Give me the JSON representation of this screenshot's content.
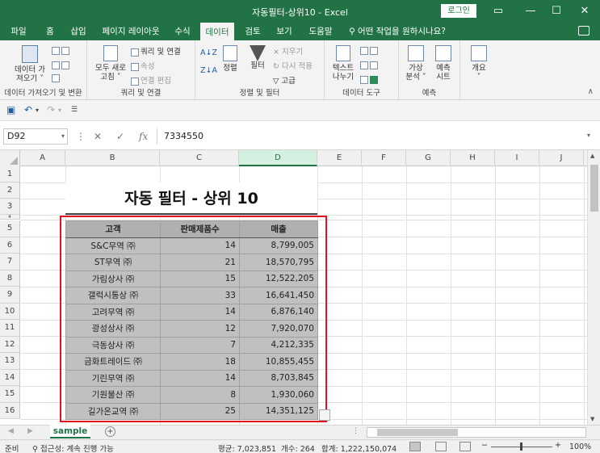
{
  "window": {
    "title": "자동필터-상위10 - Excel",
    "login_label": "로그인",
    "controls": [
      "▭",
      "—",
      "☐",
      "✕"
    ]
  },
  "tabs": [
    {
      "label": "파일"
    },
    {
      "label": "홈"
    },
    {
      "label": "삽입"
    },
    {
      "label": "페이지 레이아웃"
    },
    {
      "label": "수식"
    },
    {
      "label": "데이터"
    },
    {
      "label": "검토"
    },
    {
      "label": "보기"
    },
    {
      "label": "도움말"
    }
  ],
  "tell_me": "어떤 작업을 원하시나요?",
  "ribbon": {
    "get_data": {
      "line1": "데이터 가",
      "line2": "져오기 ˅",
      "group": "데이터 가져오기 및 변환"
    },
    "refresh": {
      "line1": "모두 새로",
      "line2": "고침 ˅"
    },
    "queries": {
      "item1": "쿼리 및 연결",
      "item2": "속성",
      "item3": "연결 편집",
      "group": "쿼리 및 연결"
    },
    "sort": {
      "label": "정렬",
      "az": "A↓Z",
      "za": "Z↓A"
    },
    "filter": {
      "label": "필터",
      "clear": "지우기",
      "reapply": "다시 적용",
      "advanced": "고급",
      "group": "정렬 및 필터"
    },
    "text_to_cols": {
      "line1": "텍스트",
      "line2": "나누기",
      "group": "데이터 도구"
    },
    "whatif": {
      "line1": "가상",
      "line2": "분석 ˅"
    },
    "forecast": {
      "line1": "예측",
      "line2": "시트",
      "group": "예측"
    },
    "outline": {
      "label": "개요",
      "sub": "˅"
    }
  },
  "formula_bar": {
    "name_box": "D92",
    "value": "7334550"
  },
  "columns": [
    "A",
    "B",
    "C",
    "D",
    "E",
    "F",
    "G",
    "H",
    "I",
    "J"
  ],
  "rows": [
    "1",
    "2",
    "3",
    "4",
    "5",
    "6",
    "7",
    "8",
    "9",
    "10",
    "11",
    "12",
    "13",
    "14",
    "15",
    "16"
  ],
  "sheet_title": "자동 필터 - 상위 10",
  "table": {
    "headers": [
      "고객",
      "판매제품수",
      "매출"
    ],
    "rows": [
      [
        "S&C무역 ㈜",
        "14",
        "8,799,005"
      ],
      [
        "ST무역 ㈜",
        "21",
        "18,570,795"
      ],
      [
        "가림상사 ㈜",
        "15",
        "12,522,205"
      ],
      [
        "갤럭시통상 ㈜",
        "33",
        "16,641,450"
      ],
      [
        "고려무역 ㈜",
        "14",
        "6,876,140"
      ],
      [
        "광성상사 ㈜",
        "12",
        "7,920,070"
      ],
      [
        "극동상사 ㈜",
        "7",
        "4,212,335"
      ],
      [
        "금화트레이드 ㈜",
        "18",
        "10,855,455"
      ],
      [
        "기린무역 ㈜",
        "14",
        "8,703,845"
      ],
      [
        "기원물산 ㈜",
        "8",
        "1,930,060"
      ],
      [
        "길가온교역 ㈜",
        "25",
        "14,351,125"
      ]
    ]
  },
  "sheet_tab": "sample",
  "status": {
    "ready": "준비",
    "accessibility": "접근성: 계속 진행 가능",
    "average": "평균: 7,023,851",
    "count": "개수: 264",
    "sum": "합계: 1,222,150,074",
    "zoom": "100%"
  }
}
